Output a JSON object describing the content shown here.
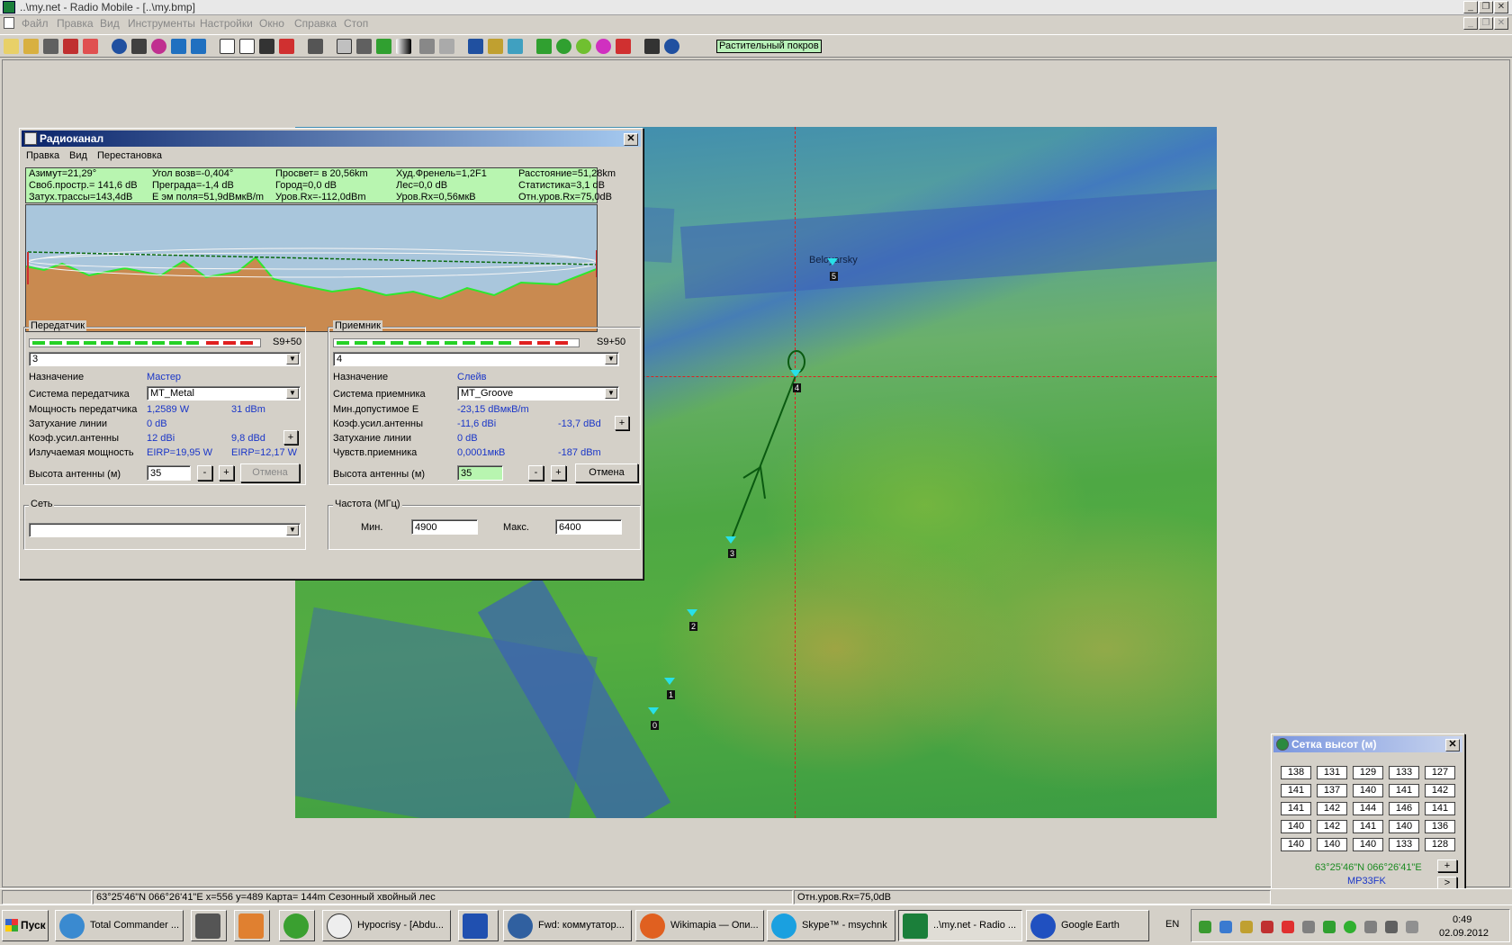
{
  "window": {
    "title": "..\\my.net - Radio Mobile - [..\\my.bmp]",
    "menu": [
      "Файл",
      "Правка",
      "Вид",
      "Инструменты",
      "Настройки",
      "Окно",
      "Справка",
      "Стоп"
    ]
  },
  "toolbar": {
    "layer_label": "Растительный покров"
  },
  "map": {
    "place_label": "Beloyarsky",
    "units": [
      "0",
      "1",
      "2",
      "3",
      "4",
      "5"
    ]
  },
  "radio_dialog": {
    "title": "Радиоканал",
    "menu": [
      "Правка",
      "Вид",
      "Перестановка"
    ],
    "stats": {
      "azimuth": "Азимут=21,29°",
      "elev_angle": "Угол возв=-0,404°",
      "clearance": "Просвет= в 20,56km",
      "worst_fresnel": "Худ.Френель=1,2F1",
      "distance": "Расстояние=51,28km",
      "free_space": "Своб.простр.= 141,6 dB",
      "obstruction": "Преграда=-1,4 dB",
      "urban": "Город=0,0 dB",
      "forest": "Лес=0,0 dB",
      "statistics": "Статистика=3,1 dB",
      "path_loss": "Затух.трассы=143,4dB",
      "field": "E эм поля=51,9dBмкВ/m",
      "rx_level_dbm": "Уров.Rx=-112,0dBm",
      "rx_level_uv": "Уров.Rx=0,56мкВ",
      "rel_level": "Отн.уров.Rx=75,0dB"
    },
    "transmitter": {
      "group_label": "Передатчик",
      "meter_label": "S9+50",
      "unit_value": "3",
      "role_label": "Назначение",
      "role_value": "Мастер",
      "system_label": "Система передатчика",
      "system_value": "MT_Metal",
      "power_label": "Мощность передатчика",
      "power_w": "1,2589 W",
      "power_dbm": "31 dBm",
      "line_loss_label": "Затухание линии",
      "line_loss_value": "0 dB",
      "gain_label": "Коэф.усил.антенны",
      "gain_dbi": "12 dBi",
      "gain_dbd": "9,8 dBd",
      "radiated_label": "Излучаемая мощность",
      "eirp": "EIRP=19,95 W",
      "erp": "EIRP=12,17 W",
      "height_label": "Высота антенны (м)",
      "height_value": "35",
      "minus": "-",
      "plus": "+",
      "cancel": "Отмена"
    },
    "receiver": {
      "group_label": "Приемник",
      "meter_label": "S9+50",
      "unit_value": "4",
      "role_label": "Назначение",
      "role_value": "Слейв",
      "system_label": "Система приемника",
      "system_value": "MT_Groove",
      "min_e_label": "Мин.допустимое E",
      "min_e_value": "-23,15 dBмкВ/m",
      "gain_label": "Коэф.усил.антенны",
      "gain_dbi": "-11,6 dBi",
      "gain_dbd": "-13,7 dBd",
      "line_loss_label": "Затухание линии",
      "line_loss_value": "0 dB",
      "sens_label": "Чувств.приемника",
      "sens_uv": "0,0001мкВ",
      "sens_dbm": "-187 dBm",
      "height_label": "Высота антенны (м)",
      "height_value": "35",
      "minus": "-",
      "plus": "+",
      "cancel": "Отмена"
    },
    "network": {
      "group_label": "Сеть",
      "value": ""
    },
    "frequency": {
      "group_label": "Частота (МГц)",
      "min_label": "Мин.",
      "min_value": "4900",
      "max_label": "Макс.",
      "max_value": "6400"
    }
  },
  "elevation_grid": {
    "title": "Сетка высот (м)",
    "rows": [
      [
        "138",
        "131",
        "129",
        "133",
        "127"
      ],
      [
        "141",
        "137",
        "140",
        "141",
        "142"
      ],
      [
        "141",
        "142",
        "144",
        "146",
        "141"
      ],
      [
        "140",
        "142",
        "141",
        "140",
        "136"
      ],
      [
        "140",
        "140",
        "140",
        "133",
        "128"
      ]
    ],
    "coords": "63°25'46\"N  066°26'41\"E",
    "locator": "MP33FK",
    "plus": "+",
    "next": ">"
  },
  "statusbar": {
    "info": "63°25'46\"N  066°26'41\"E    x=556 y=489 Карта= 144m Сезонный хвойный лес",
    "rx": "Отн.уров.Rx=75,0dB"
  },
  "taskbar": {
    "start": "Пуск",
    "tasks": [
      "Total Commander ...",
      "",
      "",
      "",
      "Hypocrisy - [Abdu...",
      "",
      "Fwd: коммутатор...",
      "Wikimapia — Опи...",
      "Skype™ - msychnk",
      "..\\my.net - Radio ...",
      "Google Earth"
    ],
    "lang": "EN",
    "time": "0:49",
    "date": "02.09.2012"
  }
}
